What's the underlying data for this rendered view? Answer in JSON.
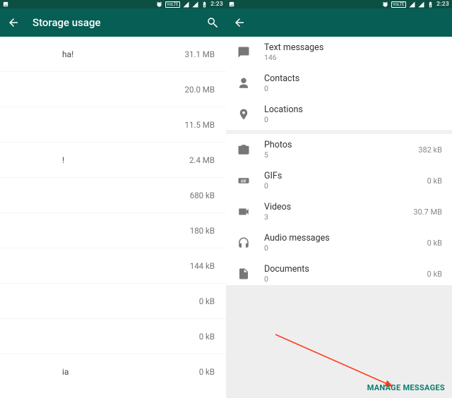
{
  "statusbar": {
    "time": "2:23",
    "lte": "VoLTE"
  },
  "left": {
    "title": "Storage usage",
    "rows": [
      {
        "name": "ha!",
        "size": "31.1 MB"
      },
      {
        "name": "",
        "size": "20.0 MB"
      },
      {
        "name": "",
        "size": "11.5 MB"
      },
      {
        "name": "!",
        "size": "2.4 MB"
      },
      {
        "name": "",
        "size": "680 kB"
      },
      {
        "name": "",
        "size": "180 kB"
      },
      {
        "name": "",
        "size": "144 kB"
      },
      {
        "name": "",
        "size": "0 kB"
      },
      {
        "name": "",
        "size": "0 kB"
      },
      {
        "name": "ia",
        "size": "0 kB"
      }
    ]
  },
  "right": {
    "sections": {
      "top": [
        {
          "icon": "text",
          "title": "Text messages",
          "count": "146",
          "size": ""
        },
        {
          "icon": "contact",
          "title": "Contacts",
          "count": "0",
          "size": ""
        },
        {
          "icon": "location",
          "title": "Locations",
          "count": "0",
          "size": ""
        }
      ],
      "media": [
        {
          "icon": "photo",
          "title": "Photos",
          "count": "5",
          "size": "382 kB"
        },
        {
          "icon": "gif",
          "title": "GIFs",
          "count": "0",
          "size": "0 kB"
        },
        {
          "icon": "video",
          "title": "Videos",
          "count": "3",
          "size": "30.7 MB"
        },
        {
          "icon": "audio",
          "title": "Audio messages",
          "count": "0",
          "size": "0 kB"
        },
        {
          "icon": "doc",
          "title": "Documents",
          "count": "0",
          "size": "0 kB"
        }
      ]
    },
    "cta": "MANAGE MESSAGES"
  }
}
